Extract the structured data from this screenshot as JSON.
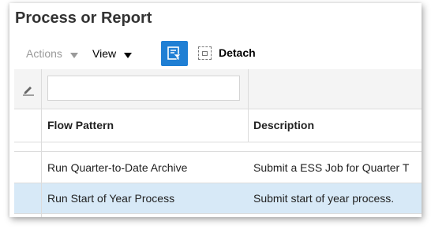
{
  "page": {
    "title": "Process or Report"
  },
  "toolbar": {
    "actions_label": "Actions",
    "view_label": "View",
    "filter_button_icon": "query-by-example-icon",
    "detach_label": "Detach",
    "detach_icon": "detach-icon"
  },
  "table": {
    "filter_placeholder": "",
    "filter_value": "",
    "edit_icon": "pencil-icon",
    "columns": [
      "Flow Pattern",
      "Description"
    ],
    "rows": [
      {
        "flow_pattern": "Run Quarter-to-Date Archive",
        "description": "Submit a ESS Job for Quarter T",
        "selected": false
      },
      {
        "flow_pattern": "Run Start of Year Process",
        "description": "Submit start of year process.",
        "selected": true
      }
    ]
  },
  "colors": {
    "accent": "#1f7fd4",
    "selected_row": "#d7e9f7",
    "disabled_text": "#9a9a9a"
  }
}
